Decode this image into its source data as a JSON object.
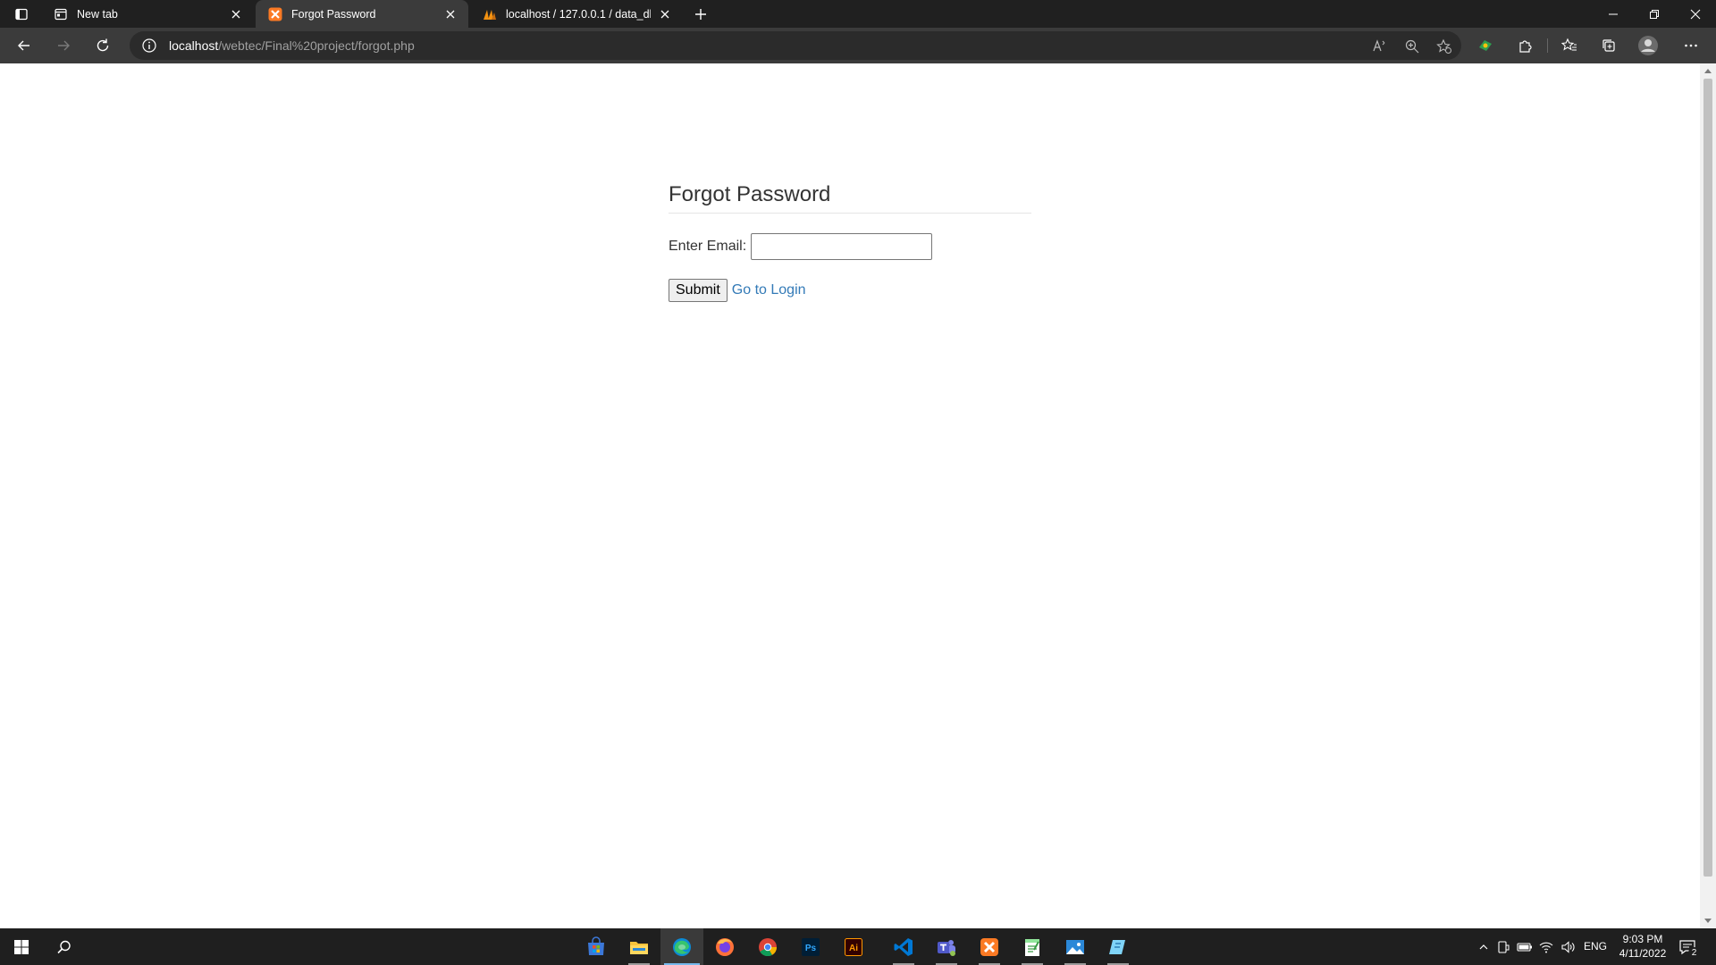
{
  "browser": {
    "tabs": [
      {
        "title": "New tab",
        "icon": "new-tab-page-icon",
        "active": false
      },
      {
        "title": "Forgot Password",
        "icon": "xampp-icon",
        "active": true
      },
      {
        "title": "localhost / 127.0.0.1 / data_db /",
        "icon": "phpmyadmin-icon",
        "active": false
      }
    ],
    "address": {
      "host": "localhost",
      "path": "/webtec/Final%20project/forgot.php"
    },
    "accent_color": "#3b3b3b"
  },
  "page": {
    "heading": "Forgot Password",
    "email_label": "Enter Email:",
    "email_value": "",
    "submit_label": "Submit",
    "login_link": "Go to Login",
    "link_color": "#337ab7"
  },
  "taskbar": {
    "apps": [
      "microsoft-store-icon",
      "file-explorer-icon",
      "edge-icon",
      "firefox-icon",
      "chrome-icon",
      "photoshop-icon",
      "illustrator-icon",
      "vscode-icon",
      "teams-icon",
      "xampp-icon",
      "notepad-plus-icon",
      "photos-icon",
      "snip-icon"
    ],
    "language": "ENG",
    "time": "9:03 PM",
    "date": "4/11/2022",
    "notifications": "2"
  }
}
